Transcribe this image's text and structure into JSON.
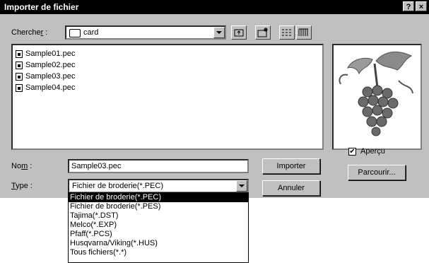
{
  "window": {
    "title": "Importer de fichier",
    "help_label": "?",
    "close_label": "×"
  },
  "lookin": {
    "label": "Chercher :",
    "value": "card"
  },
  "files": [
    {
      "name": "Sample01.pec"
    },
    {
      "name": "Sample02.pec"
    },
    {
      "name": "Sample03.pec"
    },
    {
      "name": "Sample04.pec"
    }
  ],
  "preview": {
    "checkbox_label": "Aperçu",
    "checked": true,
    "browse_label": "Parcourir...",
    "image": "grapes-icon"
  },
  "name_field": {
    "label": "Nom :",
    "value": "Sample03.pec"
  },
  "type_field": {
    "label": "Type :",
    "value": "Fichier de broderie(*.PEC)"
  },
  "buttons": {
    "import_label": "Importer",
    "cancel_label": "Annuler"
  },
  "type_options": [
    "Fichier de broderie(*.PEC)",
    "Fichier de broderie(*.PES)",
    "Tajima(*.DST)",
    "Melco(*.EXP)",
    "Pfaff(*.PCS)",
    "Husqvarna/Viking(*.HUS)",
    "Tous fichiers(*.*)"
  ],
  "type_selected_index": 0
}
